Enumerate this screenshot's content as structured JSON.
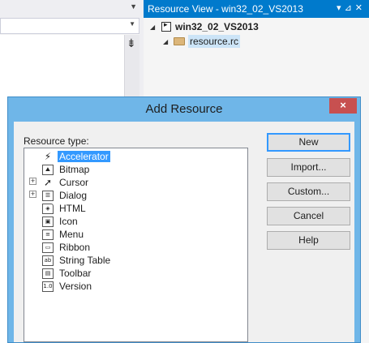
{
  "resource_view": {
    "title": "Resource View - win32_02_VS2013",
    "project": "win32_02_VS2013",
    "file": "resource.rc"
  },
  "dialog": {
    "title": "Add Resource",
    "close_label": "×",
    "list_label": "Resource type:",
    "resource_types": [
      {
        "label": "Accelerator",
        "icon": "accelerator-icon",
        "selected": true
      },
      {
        "label": "Bitmap",
        "icon": "bitmap-icon"
      },
      {
        "label": "Cursor",
        "icon": "cursor-icon",
        "expandable": true
      },
      {
        "label": "Dialog",
        "icon": "dialog-icon",
        "expandable": true
      },
      {
        "label": "HTML",
        "icon": "html-icon"
      },
      {
        "label": "Icon",
        "icon": "icon-resource-icon"
      },
      {
        "label": "Menu",
        "icon": "menu-icon"
      },
      {
        "label": "Ribbon",
        "icon": "ribbon-icon"
      },
      {
        "label": "String Table",
        "icon": "string-table-icon"
      },
      {
        "label": "Toolbar",
        "icon": "toolbar-icon"
      },
      {
        "label": "Version",
        "icon": "version-icon"
      }
    ],
    "buttons": {
      "new": "New",
      "import": "Import...",
      "custom": "Custom...",
      "cancel": "Cancel",
      "help": "Help"
    }
  },
  "colors": {
    "accent": "#007acc",
    "selection": "#3399ff",
    "dialog_frame": "#6fb6e8",
    "close_button": "#c75050"
  }
}
